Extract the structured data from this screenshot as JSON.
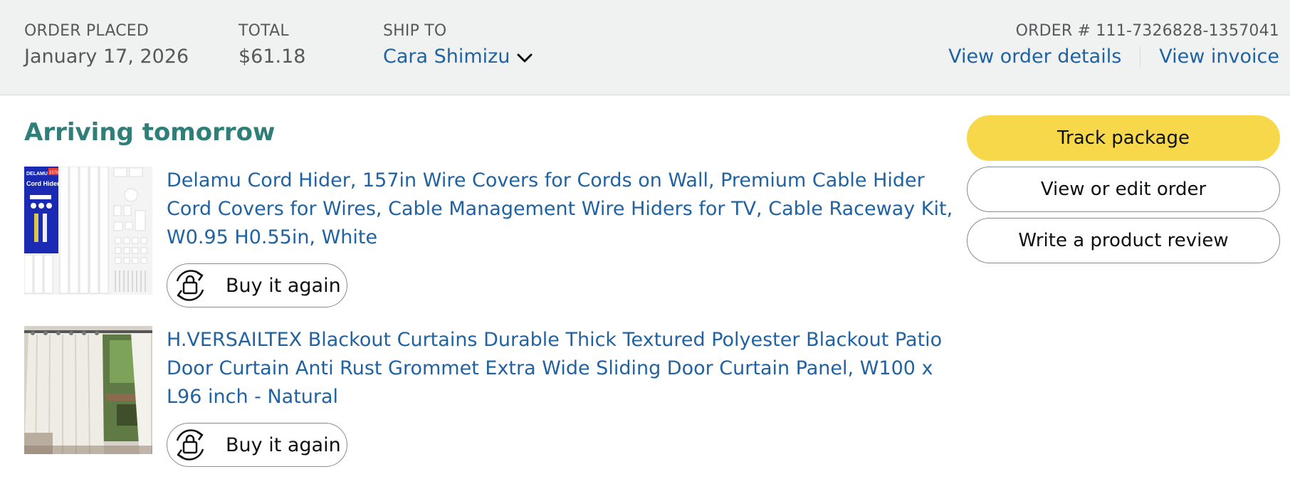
{
  "header": {
    "order_placed_label": "ORDER PLACED",
    "order_placed_value": "January 17, 2026",
    "total_label": "TOTAL",
    "total_value": "$61.18",
    "ship_to_label": "SHIP TO",
    "ship_to_value": "Cara Shimizu",
    "order_number": "ORDER # 111-7326828-1357041",
    "view_order_details": "View order details",
    "view_invoice": "View invoice"
  },
  "status": "Arriving tomorrow",
  "items": [
    {
      "title": "Delamu Cord Hider, 157in Wire Covers for Cords on Wall, Premium Cable Hider Cord Covers for Wires, Cable Management Wire Hiders for TV, Cable Raceway Kit, W0.95 H0.55in, White",
      "buy_again": "Buy it again",
      "thumb_brand": "DELAMU",
      "thumb_product": "Cord Hider",
      "thumb_badge": "157in"
    },
    {
      "title": "H.VERSAILTEX Blackout Curtains Durable Thick Textured Polyester Blackout Patio Door Curtain Anti Rust Grommet Extra Wide Sliding Door Curtain Panel, W100 x L96 inch - Natural",
      "buy_again": "Buy it again"
    }
  ],
  "actions": {
    "track": "Track package",
    "edit": "View or edit order",
    "review": "Write a product review"
  },
  "colors": {
    "header_bg": "#f0f2f2",
    "link": "#2162a1",
    "status_green": "#2f7f78",
    "primary_button": "#f7d84a"
  }
}
